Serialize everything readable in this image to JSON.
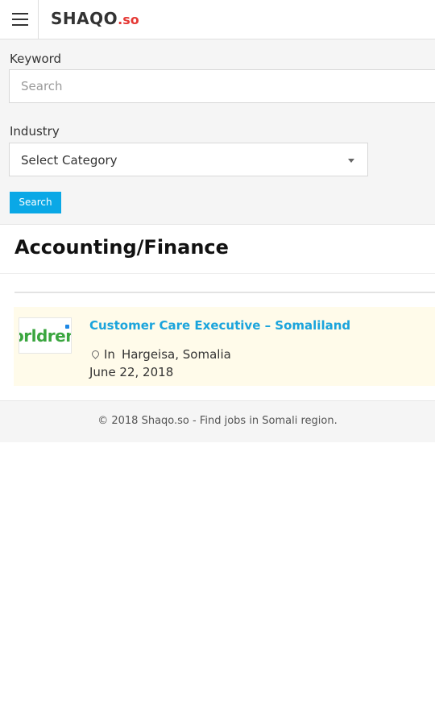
{
  "header": {
    "logo_main": "SHAQO",
    "logo_tld": ".so"
  },
  "search": {
    "keyword_label": "Keyword",
    "keyword_placeholder": "Search",
    "keyword_value": "",
    "industry_label": "Industry",
    "industry_selected": "Select Category",
    "button_label": "Search"
  },
  "page": {
    "title": "Accounting/Finance"
  },
  "jobs": [
    {
      "title": "Customer Care Executive – Somaliland",
      "location_prefix": "In",
      "location": "Hargeisa, Somalia",
      "date": "June 22, 2018",
      "company_logo_text": "orldren"
    }
  ],
  "footer": {
    "text": "© 2018 Shaqo.so - Find jobs in Somali region."
  },
  "colors": {
    "accent": "#0aa8e6",
    "link": "#1ba4dc",
    "logo_tld": "#e53935",
    "card_bg": "#fffbea"
  }
}
